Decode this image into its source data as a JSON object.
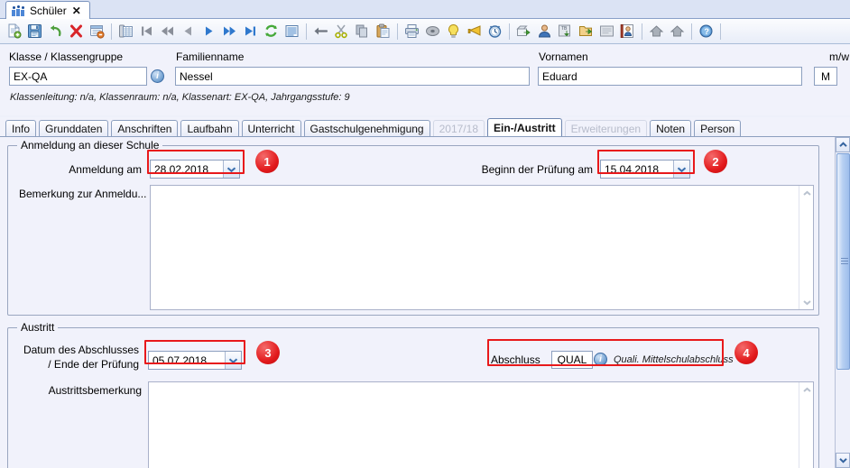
{
  "window": {
    "tab_title": "Schüler",
    "tab_icon": "people-icon",
    "tab_close": "✕"
  },
  "toolbar": {
    "groups": [
      {
        "buttons": [
          {
            "name": "new-record-button",
            "icon": "new-document-icon",
            "title": "Neu"
          },
          {
            "name": "save-button",
            "icon": "save-disk-icon",
            "title": "Speichern"
          },
          {
            "name": "undo-button",
            "icon": "undo-arrow-icon",
            "title": "Rückgängig"
          },
          {
            "name": "delete-button",
            "icon": "delete-x-icon",
            "title": "Löschen"
          },
          {
            "name": "close-record-button",
            "icon": "form-delete-icon",
            "title": "Schließen"
          }
        ]
      },
      {
        "buttons": [
          {
            "name": "list-view-button",
            "icon": "table-view-icon",
            "title": "Liste"
          },
          {
            "name": "first-record-button",
            "icon": "first-icon",
            "title": "Erster"
          },
          {
            "name": "prev-page-button",
            "icon": "prev-page-icon",
            "title": "Zurückblättern"
          },
          {
            "name": "prev-record-button",
            "icon": "prev-icon",
            "title": "Vorheriger"
          },
          {
            "name": "next-record-button",
            "icon": "next-icon",
            "title": "Nächster"
          },
          {
            "name": "next-page-button",
            "icon": "next-page-icon",
            "title": "Weiterblättern"
          },
          {
            "name": "last-record-button",
            "icon": "last-icon",
            "title": "Letzter"
          },
          {
            "name": "refresh-button",
            "icon": "refresh-icon",
            "title": "Aktualisieren"
          },
          {
            "name": "list-button",
            "icon": "lines-list-icon",
            "title": "Übersicht"
          }
        ]
      },
      {
        "buttons": [
          {
            "name": "back-button",
            "icon": "back-arrow-icon",
            "title": "Zurück"
          },
          {
            "name": "cut-button",
            "icon": "scissors-icon",
            "title": "Ausschneiden"
          },
          {
            "name": "copy-button",
            "icon": "copy-icon",
            "title": "Kopieren"
          },
          {
            "name": "paste-button",
            "icon": "paste-icon",
            "title": "Einfügen"
          }
        ]
      },
      {
        "buttons": [
          {
            "name": "print-button",
            "icon": "printer-icon",
            "title": "Drucken"
          },
          {
            "name": "disc-button",
            "icon": "disc-icon",
            "title": "Datenträger"
          },
          {
            "name": "hint-button",
            "icon": "lightbulb-icon",
            "title": "Hinweis"
          },
          {
            "name": "announce-button",
            "icon": "megaphone-icon",
            "title": "Meldung"
          },
          {
            "name": "alarm-button",
            "icon": "alarm-clock-icon",
            "title": "Termine"
          }
        ]
      },
      {
        "buttons": [
          {
            "name": "export-button",
            "icon": "export-box-icon",
            "title": "Export"
          },
          {
            "name": "user-button",
            "icon": "user-icon",
            "title": "Benutzer"
          },
          {
            "name": "transfer-button",
            "icon": "transfer-tb-icon",
            "title": "Übertragen"
          },
          {
            "name": "folder-export-button",
            "icon": "folder-arrow-icon",
            "title": "Ordner"
          },
          {
            "name": "notes-button",
            "icon": "notes-icon",
            "title": "Notizen"
          },
          {
            "name": "addressbook-button",
            "icon": "address-book-icon",
            "title": "Adressbuch"
          }
        ]
      },
      {
        "buttons": [
          {
            "name": "home-button",
            "icon": "house-icon",
            "title": "Start"
          },
          {
            "name": "school-button",
            "icon": "house-icon",
            "title": "Schule"
          }
        ]
      },
      {
        "buttons": [
          {
            "name": "help-button",
            "icon": "help-question-icon",
            "title": "Hilfe"
          }
        ]
      }
    ]
  },
  "header": {
    "klasse_label": "Klasse / Klassengruppe",
    "klasse_value": "EX-QA",
    "klasse_info_icon": "info-icon",
    "familienname_label": "Familienname",
    "familienname_value": "Nessel",
    "vornamen_label": "Vornamen",
    "vornamen_value": "Eduard",
    "gender_label": "m/w",
    "gender_value": "M",
    "class_details": "Klassenleitung: n/a, Klassenraum: n/a, Klassenart: EX-QA, Jahrgangsstufe: 9"
  },
  "page_tabs": [
    {
      "label": "Info",
      "state": "normal"
    },
    {
      "label": "Grunddaten",
      "state": "normal"
    },
    {
      "label": "Anschriften",
      "state": "normal"
    },
    {
      "label": "Laufbahn",
      "state": "normal"
    },
    {
      "label": "Unterricht",
      "state": "normal"
    },
    {
      "label": "Gastschulgenehmigung",
      "state": "normal"
    },
    {
      "label": "2017/18",
      "state": "disabled"
    },
    {
      "label": "Ein-/Austritt",
      "state": "active"
    },
    {
      "label": "Erweiterungen",
      "state": "disabled"
    },
    {
      "label": "Noten",
      "state": "normal"
    },
    {
      "label": "Person",
      "state": "normal"
    }
  ],
  "anmeldung_group": {
    "title": "Anmeldung an dieser Schule",
    "anmeldung_am_label": "Anmeldung am",
    "anmeldung_am_value": "28.02.2018",
    "pruefung_beginn_label": "Beginn der Prüfung am",
    "pruefung_beginn_value": "15.04.2018",
    "bemerkung_label": "Bemerkung zur Anmeldu...",
    "bemerkung_value": "",
    "dropdown_icon": "chevron-down-icon"
  },
  "austritt_group": {
    "title": "Austritt",
    "abschluss_datum_label_line1": "Datum des Abschlusses",
    "abschluss_datum_label_line2": "/ Ende der Prüfung",
    "abschluss_datum_value": "05.07.2018",
    "abschluss_label": "Abschluss",
    "abschluss_code": "QUAL",
    "abschluss_info_icon": "info-icon",
    "abschluss_description": "Quali. Mittelschulabschluss",
    "austrittsbemerkung_label": "Austrittsbemerkung",
    "austrittsbemerkung_value": "",
    "dropdown_icon": "chevron-down-icon"
  },
  "annotations": [
    {
      "number": "1",
      "target": "anmeldung-am-field"
    },
    {
      "number": "2",
      "target": "pruefung-beginn-field"
    },
    {
      "number": "3",
      "target": "abschluss-datum-field"
    },
    {
      "number": "4",
      "target": "abschluss-code-field"
    }
  ],
  "colors": {
    "annotation_red": "#e2191b",
    "panel_bg": "#f1f2fb",
    "border": "#8c9fbf",
    "accent_blue": "#2f6fc4"
  },
  "scrollbar": {
    "up_icon": "chevron-up-icon",
    "down_icon": "chevron-down-icon",
    "grip_icon": "grip-icon"
  }
}
